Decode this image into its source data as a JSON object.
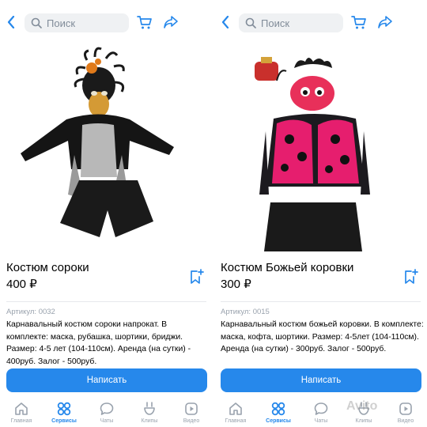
{
  "colors": {
    "accent": "#2688eb",
    "muted": "#99a2ad",
    "search_bg": "#eff1f3"
  },
  "search": {
    "placeholder": "Поиск"
  },
  "left": {
    "title": "Костюм сороки",
    "price": "400 ₽",
    "article": "Артикул: 0032",
    "description": "Карнавальный костюм сороки напрокат. В комплекте: маска, рубашка, шортики, бриджи. Размер: 4-5 лет (104-110см). Аренда (на сутки) - 400руб. Залог - 500руб.",
    "write_label": "Написать"
  },
  "right": {
    "title": "Костюм Божьей коровки",
    "price": "300 ₽",
    "article": "Артикул: 0015",
    "description": "Карнавальный костюм божьей коровки. В комплекте: маска, кофта, шортики. Размер: 4-5лет (104-110см). Аренда (на сутки) - 300руб. Залог - 500руб.",
    "write_label": "Написать"
  },
  "tabs": [
    {
      "label": "Главная",
      "icon": "home-icon",
      "active": false
    },
    {
      "label": "Сервисы",
      "icon": "services-icon",
      "active": true
    },
    {
      "label": "Чаты",
      "icon": "chat-icon",
      "active": false
    },
    {
      "label": "Клипы",
      "icon": "clips-icon",
      "active": false
    },
    {
      "label": "Видео",
      "icon": "video-icon",
      "active": false
    }
  ],
  "watermark": "Avito"
}
